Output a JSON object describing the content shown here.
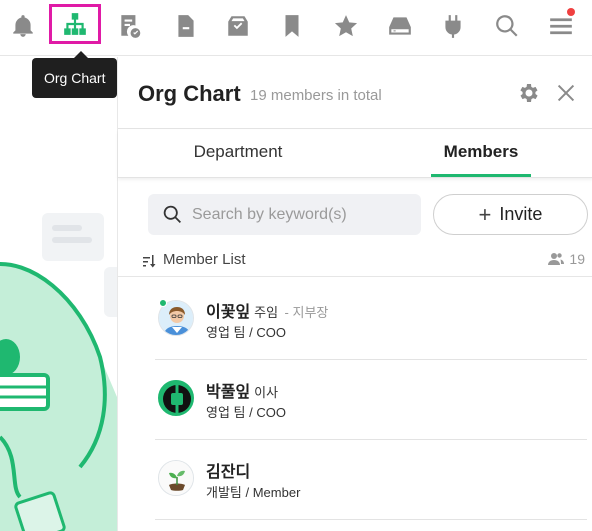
{
  "toolbar": {
    "icons": [
      "bell-icon",
      "org-chart-icon",
      "approval-icon",
      "document-icon",
      "archive-icon",
      "bookmark-icon",
      "star-icon",
      "drive-icon",
      "plugin-icon",
      "search-icon",
      "menu-icon"
    ],
    "active": "org-chart-icon",
    "notification_color": "#f04040"
  },
  "tooltip": {
    "text": "Org Chart"
  },
  "panel": {
    "title": "Org Chart",
    "subtitle": "19 members in total",
    "tabs": [
      {
        "label": "Department",
        "active": false
      },
      {
        "label": "Members",
        "active": true
      }
    ],
    "search": {
      "placeholder": "Search by keyword(s)",
      "value": ""
    },
    "invite_label": "Invite",
    "list_label": "Member List",
    "member_count": "19",
    "members": [
      {
        "name": "이꽃잎",
        "title": "주임",
        "extra": "- 지부장",
        "dept": "영업 팀 / COO",
        "online": true,
        "avatar": "person-avatar"
      },
      {
        "name": "박풀잎",
        "title": "이사",
        "extra": "",
        "dept": "영업 팀 / COO",
        "online": false,
        "avatar": "plug-avatar"
      },
      {
        "name": "김잔디",
        "title": "",
        "extra": "",
        "dept": "개발팀 / Member",
        "online": false,
        "avatar": "plant-avatar"
      }
    ]
  },
  "colors": {
    "accent": "#1fb870",
    "highlight": "#e01aa6"
  }
}
